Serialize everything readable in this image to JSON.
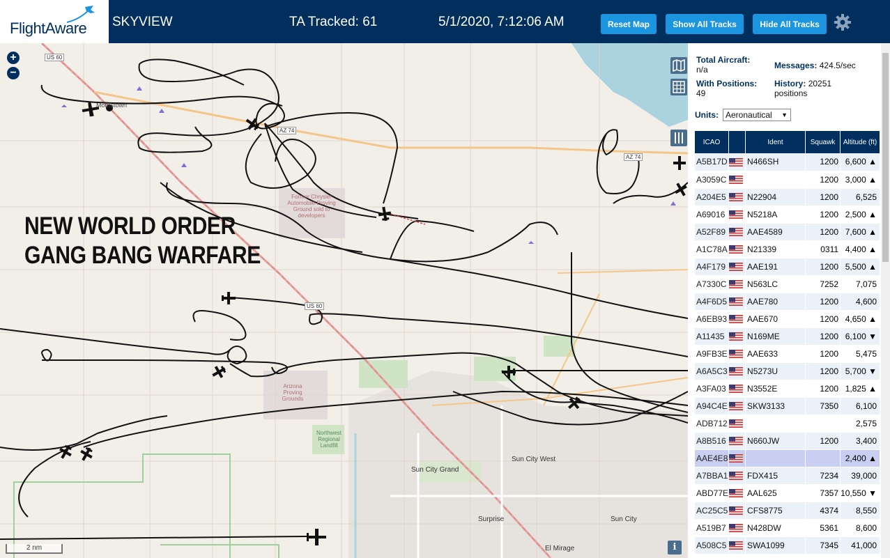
{
  "header": {
    "logo_text": "FlightAware",
    "app_name": "SKYVIEW",
    "tracked": "TA Tracked: 61",
    "datetime": "5/1/2020, 7:12:06 AM",
    "buttons": {
      "reset": "Reset Map",
      "show": "Show All Tracks",
      "hide": "Hide All Tracks"
    }
  },
  "map": {
    "zoom_in": "+",
    "zoom_out": "−",
    "overlay_line1": "NEW WORLD ORDER",
    "overlay_line2": "GANG BANG WARFARE",
    "scale": "2 nm",
    "labels": {
      "proving1": "Former Chrysler Automobile Proving Ground sold to developers",
      "proving2": "Arizona Proving Grounds",
      "landfill": "Northwest Regional Landfill",
      "sun_city_grand": "Sun City Grand",
      "sun_city_west": "Sun City West",
      "surprise": "Surprise",
      "sun_city": "Sun City",
      "el_mirage": "El Mirage",
      "us60a": "US 60",
      "us60b": "US 60",
      "az74a": "AZ 74",
      "az74b": "AZ 74",
      "morristown": "Morristown"
    },
    "icons": {
      "layers": "map-layers-icon",
      "grid": "grid-icon",
      "columns": "columns-icon",
      "info": "info-icon"
    },
    "info_glyph": "i"
  },
  "panel": {
    "total_aircraft_label": "Total Aircraft:",
    "total_aircraft_value": "n/a",
    "with_positions_label": "With Positions:",
    "with_positions_value": "49",
    "messages_label": "Messages:",
    "messages_value": "424.5/sec",
    "history_label": "History:",
    "history_value": "20251 positions",
    "units_label": "Units:",
    "units_value": "Aeronautical",
    "columns": [
      "ICAO",
      "",
      "Ident",
      "Squawk",
      "Altitude (ft)"
    ],
    "rows": [
      {
        "icao": "A5B17D",
        "ident": "N466SH",
        "squawk": "1200",
        "alt": "6,600 ▲"
      },
      {
        "icao": "A3059C",
        "ident": "",
        "squawk": "1200",
        "alt": "3,000 ▲"
      },
      {
        "icao": "A204E5",
        "ident": "N22904",
        "squawk": "1200",
        "alt": "6,525"
      },
      {
        "icao": "A69016",
        "ident": "N5218A",
        "squawk": "1200",
        "alt": "2,500 ▲"
      },
      {
        "icao": "A52F89",
        "ident": "AAE4589",
        "squawk": "1200",
        "alt": "7,600 ▲"
      },
      {
        "icao": "A1C78A",
        "ident": "N21339",
        "squawk": "0311",
        "alt": "4,400 ▲"
      },
      {
        "icao": "A4F179",
        "ident": "AAE191",
        "squawk": "1200",
        "alt": "5,500 ▲"
      },
      {
        "icao": "A7330C",
        "ident": "N563LC",
        "squawk": "7252",
        "alt": "7,075"
      },
      {
        "icao": "A4F6D5",
        "ident": "AAE780",
        "squawk": "1200",
        "alt": "4,600"
      },
      {
        "icao": "A6EB93",
        "ident": "AAE670",
        "squawk": "1200",
        "alt": "4,650 ▲"
      },
      {
        "icao": "A11435",
        "ident": "N169ME",
        "squawk": "1200",
        "alt": "6,100 ▼"
      },
      {
        "icao": "A9FB3E",
        "ident": "AAE633",
        "squawk": "1200",
        "alt": "5,475"
      },
      {
        "icao": "A6A5C3",
        "ident": "N5273U",
        "squawk": "1200",
        "alt": "5,700 ▼"
      },
      {
        "icao": "A3FA03",
        "ident": "N3552E",
        "squawk": "1200",
        "alt": "1,825 ▲"
      },
      {
        "icao": "A94C4E",
        "ident": "SKW3133",
        "squawk": "7350",
        "alt": "6,100"
      },
      {
        "icao": "ADB712",
        "ident": "",
        "squawk": "",
        "alt": "2,575"
      },
      {
        "icao": "A8B516",
        "ident": "N660JW",
        "squawk": "1200",
        "alt": "3,400"
      },
      {
        "icao": "AAE4E8",
        "ident": "",
        "squawk": "",
        "alt": "2,400 ▲",
        "selected": true
      },
      {
        "icao": "A7BBA1",
        "ident": "FDX415",
        "squawk": "7234",
        "alt": "39,000"
      },
      {
        "icao": "ABD77E",
        "ident": "AAL625",
        "squawk": "7357",
        "alt": "10,550 ▼"
      },
      {
        "icao": "AC25C5",
        "ident": "CFS8775",
        "squawk": "4374",
        "alt": "8,550"
      },
      {
        "icao": "A519B7",
        "ident": "N428DW",
        "squawk": "5361",
        "alt": "8,600"
      },
      {
        "icao": "A508C5",
        "ident": "SWA1099",
        "squawk": "7345",
        "alt": "41,000"
      }
    ]
  },
  "colors": {
    "header_bg": "#002f5d",
    "button_bg": "#1b95e0",
    "row_alt": "#eaf1f8",
    "row_selected": "#c8cff0"
  }
}
